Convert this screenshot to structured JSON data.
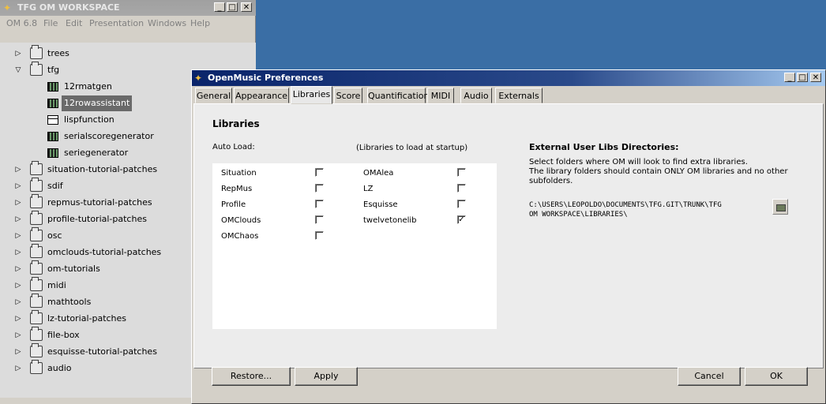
{
  "workspace": {
    "title": "TFG OM WORKSPACE",
    "menu": [
      "OM 6.8",
      "File",
      "Edit",
      "Presentation",
      "Windows",
      "Help"
    ],
    "tree": [
      {
        "label": "trees",
        "type": "folder",
        "expanded": false
      },
      {
        "label": "tfg",
        "type": "folder",
        "expanded": true
      },
      {
        "label": "12rmatgen",
        "type": "patch"
      },
      {
        "label": "12rowassistant",
        "type": "patch",
        "selected": true
      },
      {
        "label": "lispfunction",
        "type": "lisp"
      },
      {
        "label": "serialscoregenerator",
        "type": "patch"
      },
      {
        "label": "seriegenerator",
        "type": "patch"
      },
      {
        "label": "situation-tutorial-patches",
        "type": "folder",
        "expanded": false
      },
      {
        "label": "sdif",
        "type": "folder",
        "expanded": false
      },
      {
        "label": "repmus-tutorial-patches",
        "type": "folder",
        "expanded": false
      },
      {
        "label": "profile-tutorial-patches",
        "type": "folder",
        "expanded": false
      },
      {
        "label": "osc",
        "type": "folder",
        "expanded": false
      },
      {
        "label": "omclouds-tutorial-patches",
        "type": "folder",
        "expanded": false
      },
      {
        "label": "om-tutorials",
        "type": "folder",
        "expanded": false
      },
      {
        "label": "midi",
        "type": "folder",
        "expanded": false
      },
      {
        "label": "mathtools",
        "type": "folder",
        "expanded": false
      },
      {
        "label": "lz-tutorial-patches",
        "type": "folder",
        "expanded": false
      },
      {
        "label": "file-box",
        "type": "folder",
        "expanded": false
      },
      {
        "label": "esquisse-tutorial-patches",
        "type": "folder",
        "expanded": false
      },
      {
        "label": "audio",
        "type": "folder",
        "expanded": false
      }
    ]
  },
  "prefs": {
    "title": "OpenMusic Preferences",
    "tabs": [
      "General",
      "Appearance",
      "Libraries",
      "Score",
      "Quantification",
      "MIDI",
      "Audio",
      "Externals"
    ],
    "active_tab": "Libraries",
    "section_title": "Libraries",
    "auto_load_label": "Auto Load:",
    "startup_label": "(Libraries to load at startup)",
    "libraries_left": [
      {
        "name": "Situation",
        "checked": false
      },
      {
        "name": "RepMus",
        "checked": false
      },
      {
        "name": "Profile",
        "checked": false
      },
      {
        "name": "OMClouds",
        "checked": false
      },
      {
        "name": "OMChaos",
        "checked": false
      }
    ],
    "libraries_right": [
      {
        "name": "OMAlea",
        "checked": false
      },
      {
        "name": "LZ",
        "checked": false
      },
      {
        "name": "Esquisse",
        "checked": false
      },
      {
        "name": "twelvetonelib",
        "checked": true
      }
    ],
    "external_title": "External User Libs Directories:",
    "external_desc_1": "Select folders where OM will look to find extra libraries.",
    "external_desc_2": "The library folders should contain ONLY OM libraries and no other",
    "external_desc_3": "subfolders.",
    "path_line_1": "C:\\USERS\\LEOPOLDO\\DOCUMENTS\\TFG.GIT\\TRUNK\\TFG",
    "path_line_2": "OM WORKSPACE\\LIBRARIES\\",
    "buttons": {
      "restore": "Restore...",
      "apply": "Apply",
      "cancel": "Cancel",
      "ok": "OK"
    }
  }
}
